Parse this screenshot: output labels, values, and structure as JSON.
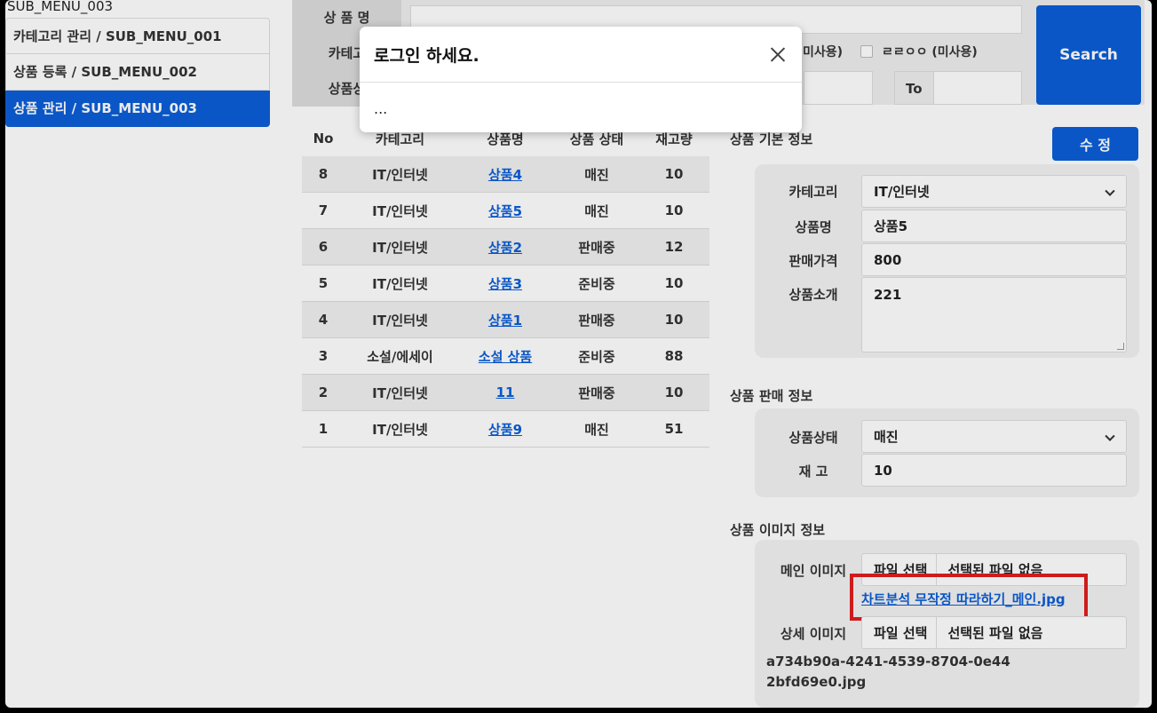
{
  "sidebar": {
    "top_label": "SUB_MENU_003",
    "items": [
      {
        "label": "카테고리 관리 / SUB_MENU_001"
      },
      {
        "label": "상품 등록 / SUB_MENU_002"
      },
      {
        "label": "상품 관리 / SUB_MENU_003",
        "active": true
      }
    ]
  },
  "search": {
    "label_name": "상 품 명",
    "label_category": "카테고",
    "label_status": "상품상",
    "check1": "미사용)",
    "check2": "ㄹㄹㅇㅇ (미사용)",
    "to_label": "To",
    "button": "Search"
  },
  "list": {
    "headers": [
      "No",
      "카테고리",
      "상품명",
      "상품 상태",
      "재고량"
    ],
    "rows": [
      {
        "no": "8",
        "cat": "IT/인터넷",
        "name": "상품4",
        "status": "매진",
        "qty": "10"
      },
      {
        "no": "7",
        "cat": "IT/인터넷",
        "name": "상품5",
        "status": "매진",
        "qty": "10"
      },
      {
        "no": "6",
        "cat": "IT/인터넷",
        "name": "상품2",
        "status": "판매중",
        "qty": "12"
      },
      {
        "no": "5",
        "cat": "IT/인터넷",
        "name": "상품3",
        "status": "준비중",
        "qty": "10"
      },
      {
        "no": "4",
        "cat": "IT/인터넷",
        "name": "상품1",
        "status": "판매중",
        "qty": "10"
      },
      {
        "no": "3",
        "cat": "소설/에세이",
        "name": "소설 상품",
        "status": "준비중",
        "qty": "88"
      },
      {
        "no": "2",
        "cat": "IT/인터넷",
        "name": "11",
        "status": "판매중",
        "qty": "10"
      },
      {
        "no": "1",
        "cat": "IT/인터넷",
        "name": "상품9",
        "status": "매진",
        "qty": "51"
      }
    ]
  },
  "detail": {
    "basic_title": "상품 기본 정보",
    "edit_button": "수 정",
    "category_label": "카테고리",
    "category_value": "IT/인터넷",
    "name_label": "상품명",
    "name_value": "상품5",
    "price_label": "판매가격",
    "price_value": "800",
    "desc_label": "상품소개",
    "desc_value": "221",
    "sales_title": "상품 판매 정보",
    "status_label": "상품상태",
    "status_value": "매진",
    "stock_label": "재 고",
    "stock_value": "10",
    "image_title": "상품 이미지 정보",
    "main_image_label": "메인 이미지",
    "file_button": "파일 선택",
    "no_file": "선택된 파일 없음",
    "main_image_link": "차트분석 무작정 따라하기_메인.jpg",
    "detail_image_label": "상세 이미지",
    "detail_file_name": "a734b90a-4241-4539-8704-0e442bfd69e0.jpg"
  },
  "modal": {
    "title": "로그인 하세요.",
    "body": "..."
  }
}
